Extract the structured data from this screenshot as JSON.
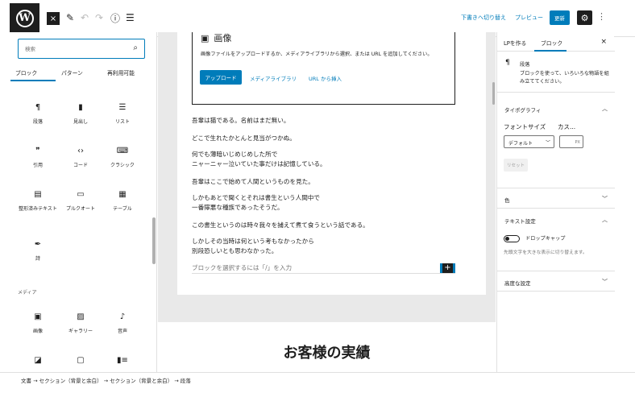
{
  "toolbar": {
    "logo": "W",
    "close_icon": "×",
    "edit_icon": "✎",
    "undo_icon": "↶",
    "redo_icon": "↷",
    "info_icon": "ⓘ",
    "outline_icon": "☰",
    "switch_draft": "下書きへ切り替え",
    "preview": "プレビュー",
    "update": "更新",
    "settings_icon": "⚙",
    "more_icon": "⋮"
  },
  "inserter": {
    "search_placeholder": "検索",
    "search_icon": "⌕",
    "tabs": [
      "ブロック",
      "パターン",
      "再利用可能"
    ],
    "blocks": [
      {
        "icon": "¶",
        "label": "段落"
      },
      {
        "icon": "▮",
        "label": "見出し"
      },
      {
        "icon": "☰",
        "label": "リスト"
      },
      {
        "icon": "❞",
        "label": "引用"
      },
      {
        "icon": "‹›",
        "label": "コード"
      },
      {
        "icon": "⌨",
        "label": "クラシック"
      },
      {
        "icon": "▤",
        "label": "整形済みテキスト"
      },
      {
        "icon": "▭",
        "label": "プルクオート"
      },
      {
        "icon": "▦",
        "label": "テーブル"
      },
      {
        "icon": "✒",
        "label": "詩"
      }
    ],
    "media_label": "メディア",
    "media_blocks": [
      {
        "icon": "▣",
        "label": "画像"
      },
      {
        "icon": "▨",
        "label": "ギャラリー"
      },
      {
        "icon": "♪",
        "label": "音声"
      },
      {
        "icon": "◪",
        "label": ""
      },
      {
        "icon": "▢",
        "label": ""
      },
      {
        "icon": "▮≡",
        "label": ""
      }
    ]
  },
  "editor": {
    "image_block": {
      "icon": "▣",
      "title": "画像",
      "description": "画像ファイルをアップロードするか、メディアライブラリから選択、または URL を追加してください。",
      "upload": "アップロード",
      "media_library": "メディアライブラリ",
      "insert_url": "URL から挿入"
    },
    "paragraphs": [
      [
        "吾輩は猫である。名前はまだ無い。"
      ],
      [
        "どこで生れたかとんと見当がつかぬ。"
      ],
      [
        "何でも薄暗いじめじめした所で",
        "ニャーニャー泣いていた事だけは記憶している。"
      ],
      [
        "吾輩はここで始めて人間というものを見た。"
      ],
      [
        "しかもあとで聞くとそれは書生という人間中で",
        "一番獰悪な種族であったそうだ。"
      ],
      [
        "この書生というのは時々我々を捕えて煮て食うという話である。"
      ],
      [
        "しかしその当時は何という考もなかったから",
        "別段恐しいとも思わなかった。"
      ]
    ],
    "appender_placeholder": "ブロックを選択するには「/」を入力",
    "appender_icon": "+",
    "heading": "お客様の実績"
  },
  "sidebar": {
    "tabs": [
      "LPを作る",
      "ブロック"
    ],
    "close_icon": "×",
    "block_icon": "¶",
    "block_name": "段落",
    "block_desc": "ブロックを使って、いろいろな物語を組み立ててください。",
    "typography": "タイポグラフィ",
    "font_size": "フォントサイズ",
    "custom": "カス...",
    "select_value": "デフォルト",
    "custom_unit": "PX",
    "reset": "リセット",
    "color": "色",
    "text_settings": "テキスト設定",
    "drop_cap": "ドロップキャップ",
    "drop_cap_help": "先頭文字を大きな表示に切り替えます。",
    "advanced": "高度な設定",
    "chev_up": "︿",
    "chev_down": "﹀"
  },
  "breadcrumb": "文書 → セクション（背景と余白） → セクション（背景と余白） → 段落"
}
